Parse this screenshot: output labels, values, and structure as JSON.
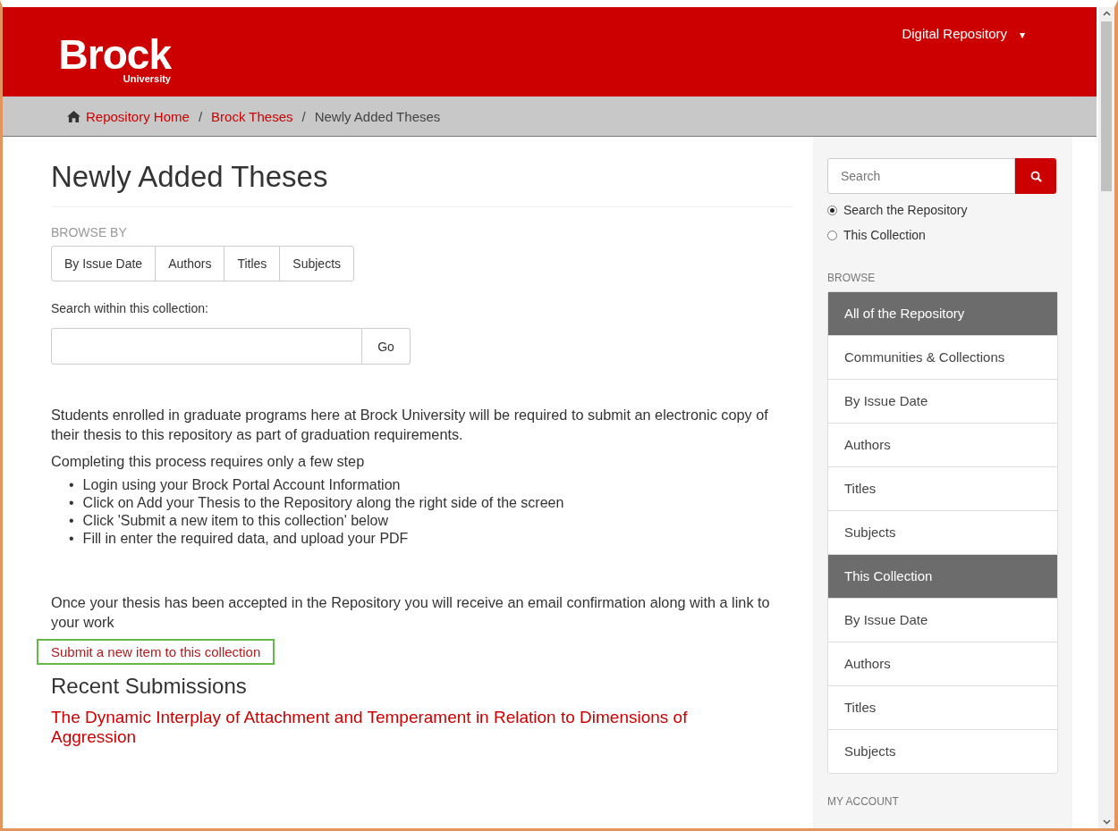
{
  "header": {
    "logo": {
      "wordmark": "Brock",
      "subtitle": "University"
    },
    "menu": {
      "label": "Digital Repository",
      "caret": "▾"
    }
  },
  "breadcrumb": [
    {
      "label": "Repository Home",
      "link": true
    },
    {
      "label": "Brock Theses",
      "link": true
    },
    {
      "label": "Newly Added Theses",
      "link": false
    }
  ],
  "breadcrumb_separator": "/",
  "main": {
    "title": "Newly Added Theses",
    "browse_by": {
      "label": "BROWSE BY",
      "buttons": [
        "By Issue Date",
        "Authors",
        "Titles",
        "Subjects"
      ]
    },
    "search": {
      "label": "Search within this collection:",
      "button": "Go"
    },
    "intro": "Students enrolled in graduate programs here at Brock University will be required to submit an electronic copy of their thesis to this repository as part of graduation requirements.",
    "steps_intro": "Completing this process requires only a few step",
    "steps": [
      {
        "bullet": "•",
        "text": "Login using your Brock Portal Account Information"
      },
      {
        "bullet": "•",
        "text": "Click on Add your Thesis to the Repository along the right side of the screen"
      },
      {
        "bullet": "•",
        "text": "Click 'Submit a new item to this collection' below"
      },
      {
        "bullet": "•",
        "text": "Fill in enter the required data, and upload your PDF"
      }
    ],
    "outro": "Once your thesis has been accepted in the Repository you will receive an email confirmation along with a link to your work",
    "submit_link": {
      "label": "Submit a new item to this collection",
      "highlighted": true
    },
    "recent": {
      "title": "Recent Submissions",
      "items": [
        "The Dynamic Interplay of Attachment and Temperament in Relation to Dimensions of Aggression"
      ]
    }
  },
  "sidebar": {
    "search": {
      "placeholder": "Search"
    },
    "scope": [
      {
        "label": "Search the Repository",
        "selected": true
      },
      {
        "label": "This Collection",
        "selected": false
      }
    ],
    "browse_label": "BROWSE",
    "browse": [
      {
        "kind": "header",
        "label": "All of the Repository"
      },
      {
        "kind": "link",
        "label": "Communities & Collections"
      },
      {
        "kind": "link",
        "label": "By Issue Date"
      },
      {
        "kind": "link",
        "label": "Authors"
      },
      {
        "kind": "link",
        "label": "Titles"
      },
      {
        "kind": "link",
        "label": "Subjects"
      },
      {
        "kind": "header",
        "label": "This Collection"
      },
      {
        "kind": "link",
        "label": "By Issue Date"
      },
      {
        "kind": "link",
        "label": "Authors"
      },
      {
        "kind": "link",
        "label": "Titles"
      },
      {
        "kind": "link",
        "label": "Subjects"
      }
    ],
    "account_label": "MY ACCOUNT"
  }
}
